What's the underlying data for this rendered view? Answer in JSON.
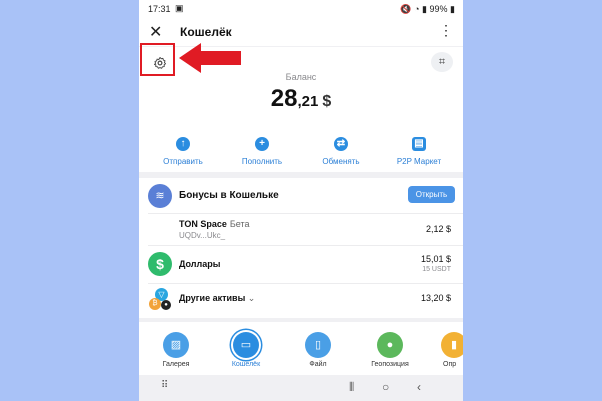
{
  "status": {
    "time": "17:31",
    "battery": "99%"
  },
  "header": {
    "title": "Кошелёк",
    "close_icon": "close-icon",
    "menu_icon": "more-vert-icon"
  },
  "balance": {
    "label": "Баланс",
    "integer": "28",
    "fraction": ",21",
    "currency": "$"
  },
  "actions": [
    {
      "label": "Отправить",
      "icon": "arrow-up-icon"
    },
    {
      "label": "Пополнить",
      "icon": "plus-icon"
    },
    {
      "label": "Обменять",
      "icon": "swap-icon"
    },
    {
      "label": "P2P Маркет",
      "icon": "store-icon"
    }
  ],
  "bonus": {
    "title": "Бонусы в Кошельке",
    "button": "Открыть"
  },
  "assets": {
    "ton_space": {
      "name": "TON Space",
      "tag": "Бета",
      "address": "UQDv...Ukc_",
      "value": "2,12 $"
    },
    "dollars": {
      "name": "Доллары",
      "value": "15,01 $",
      "amount": "15 USDT"
    },
    "other": {
      "name": "Другие активы",
      "value": "13,20 $"
    }
  },
  "tabs": [
    {
      "label": "Галерея",
      "color": "#4a9fe6",
      "icon": "gallery-icon"
    },
    {
      "label": "Кошелёк",
      "color": "#2b8de0",
      "icon": "wallet-icon"
    },
    {
      "label": "Файл",
      "color": "#4a9fe6",
      "icon": "file-icon"
    },
    {
      "label": "Геопозиция",
      "color": "#5cb85c",
      "icon": "location-icon"
    },
    {
      "label": "Опр",
      "color": "#f2b134",
      "icon": "poll-icon"
    }
  ],
  "colors": {
    "accent": "#2b8de0",
    "highlight": "#e01b24",
    "background": "#a9c2f7"
  }
}
